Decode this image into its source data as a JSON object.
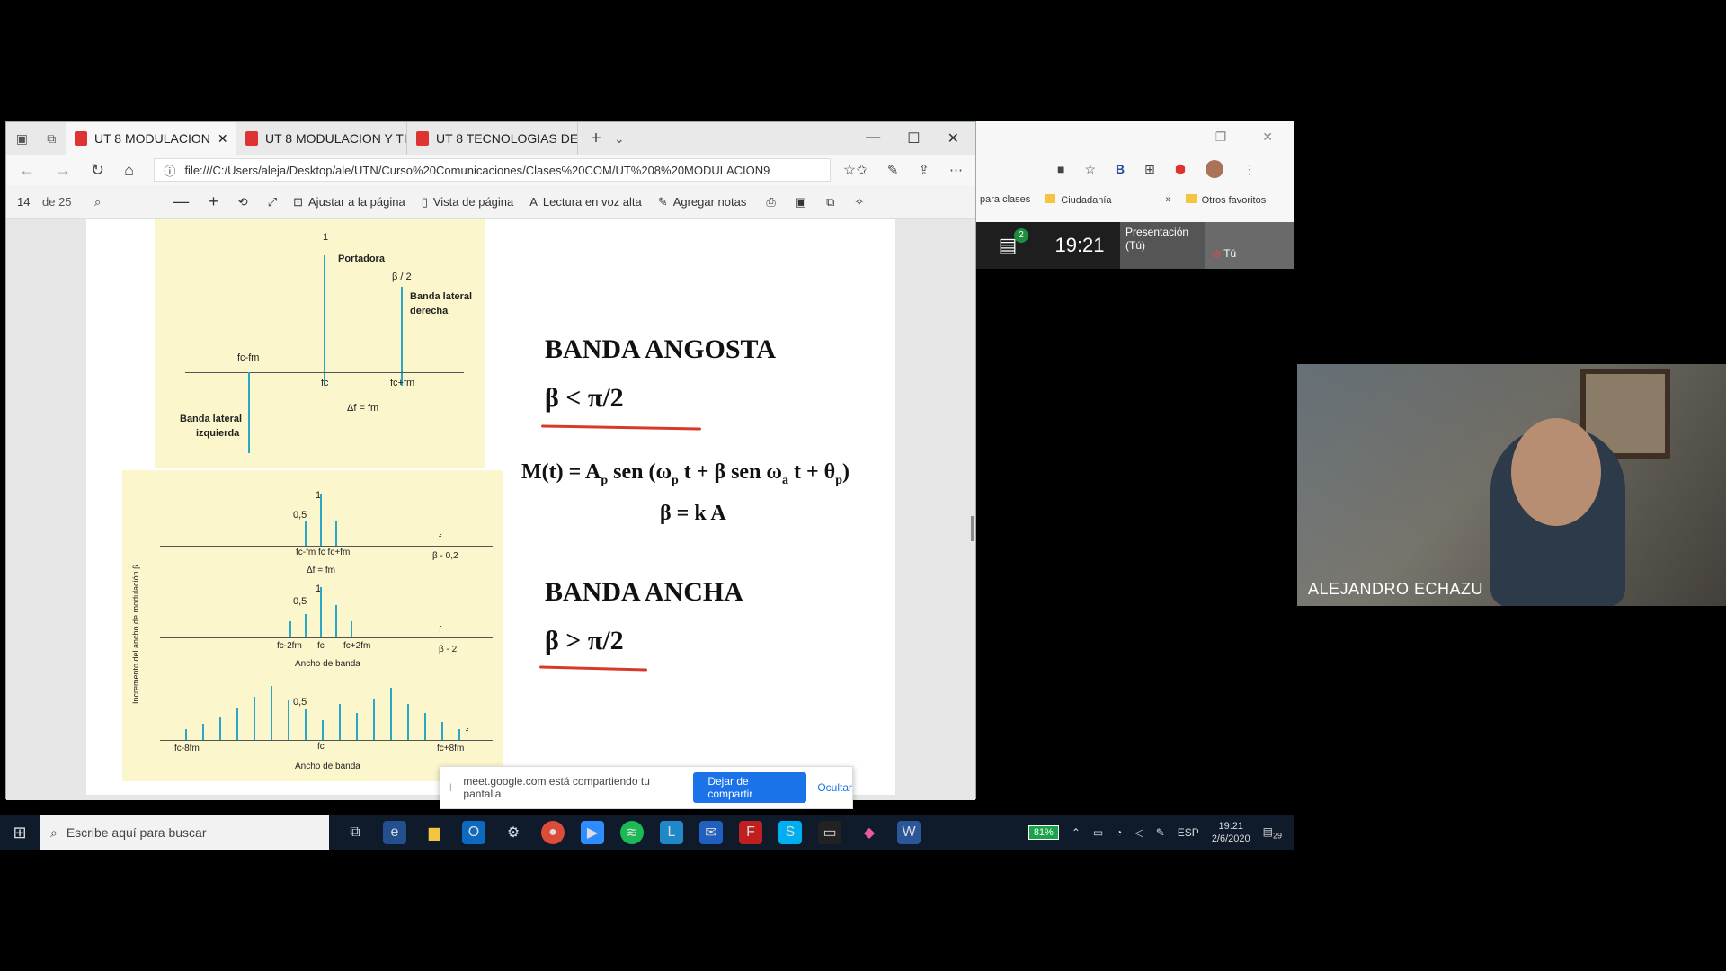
{
  "edge": {
    "tabs": [
      {
        "label": "UT 8 MODULACION"
      },
      {
        "label": "UT 8 MODULACION Y TI"
      },
      {
        "label": "UT 8 TECNOLOGIAS DE"
      }
    ],
    "url": "file:///C:/Users/aleja/Desktop/ale/UTN/Curso%20Comunicaciones/Clases%20COM/UT%208%20MODULACION9",
    "page_number": "14",
    "page_of": "de 25",
    "toolbar": {
      "fit_page": "Ajustar a la página",
      "page_view": "Vista de página",
      "read_aloud": "Lectura en voz alta",
      "add_notes": "Agregar notas"
    }
  },
  "slide": {
    "fig1": {
      "one": "1",
      "portadora": "Portadora",
      "beta2": "β / 2",
      "banda_der_1": "Banda lateral",
      "banda_der_2": "derecha",
      "fcfm_left": "fc-fm",
      "fc": "fc",
      "fcfm_right": "fc+fm",
      "delta": "Δf = fm",
      "banda_izq_1": "Banda lateral",
      "banda_izq_2": "izquierda"
    },
    "fig2": {
      "one_a": "1",
      "half_a": "0,5",
      "f_a": "f",
      "ticks_a": "fc-fm  fc  fc+fm",
      "delta_a": "Δf = fm",
      "beta_a": "β - 0,2",
      "one_b": "1",
      "half_b": "0,5",
      "f_b": "f",
      "ticks_b_l": "fc-2fm",
      "ticks_b_c": "fc",
      "ticks_b_r": "fc+2fm",
      "beta_b": "β - 2",
      "ancho_b": "Ancho de banda",
      "half_c": "0,5",
      "f_c": "f",
      "ticks_c_l": "fc-8fm",
      "ticks_c_c": "fc",
      "ticks_c_r": "fc+8fm",
      "ancho_c": "Ancho de banda",
      "ylabel": "Incremento del ancho de modulación β"
    },
    "narrow_title": "BANDA ANGOSTA",
    "narrow_cond": "β < π/2",
    "eq1_a": "M(t) = A",
    "eq1_p": "p",
    "eq1_b": " sen (ω",
    "eq1_p2": "p",
    "eq1_c": " t + β sen ω",
    "eq1_a2": "a",
    "eq1_d": " t + θ",
    "eq1_p3": "p",
    "eq1_e": ")",
    "eq2": "β = k A",
    "wide_title": "BANDA ANCHA",
    "wide_cond": "β > π/2"
  },
  "share_bar": {
    "text": "meet.google.com está compartiendo tu pantalla.",
    "stop": "Dejar de compartir",
    "hide": "Ocultar"
  },
  "chrome": {
    "bookmarks": [
      "para clases",
      "Ciudadanía",
      "»",
      "Otros favoritos"
    ]
  },
  "meet": {
    "chat_count": "2",
    "time": "19:21",
    "presenting": "Presentación (Tú)",
    "you": "Tú"
  },
  "participant": {
    "name": "ALEJANDRO ECHAZU"
  },
  "taskbar": {
    "search": "Escribe aquí para buscar",
    "battery": "81%",
    "lang": "ESP",
    "time": "19:21",
    "date": "2/6/2020",
    "notif": "29"
  }
}
